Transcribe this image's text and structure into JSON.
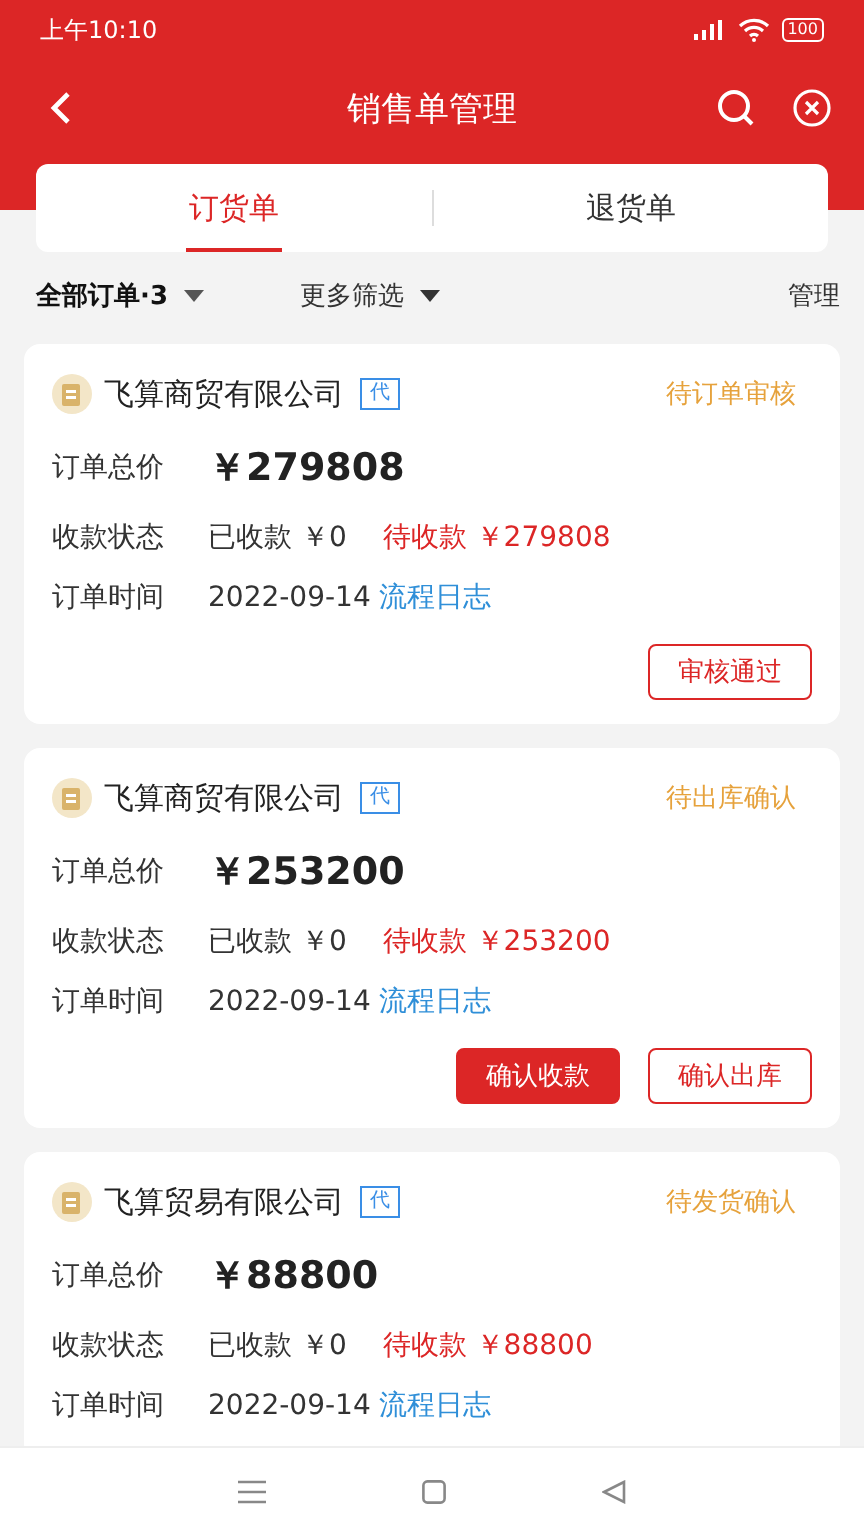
{
  "status_bar": {
    "time": "上午10:10",
    "battery": "100"
  },
  "header": {
    "title": "销售单管理"
  },
  "tabs": [
    {
      "label": "订货单",
      "selected": true
    },
    {
      "label": "退货单",
      "selected": false
    }
  ],
  "filters": {
    "all_orders": "全部订单·3",
    "more_filters": "更多筛选",
    "manage": "管理"
  },
  "orders": [
    {
      "company": "飞算商贸有限公司",
      "tag": "代",
      "status": "待订单审核",
      "total_label": "订单总价",
      "total": "￥279808",
      "payment_label": "收款状态",
      "received": "已收款 ￥0",
      "pending": "待收款 ￥279808",
      "time_label": "订单时间",
      "date": "2022-09-14",
      "log_link": "流程日志",
      "buttons": [
        {
          "label": "审核通过",
          "kind": "outline"
        }
      ]
    },
    {
      "company": "飞算商贸有限公司",
      "tag": "代",
      "status": "待出库确认",
      "total_label": "订单总价",
      "total": "￥253200",
      "payment_label": "收款状态",
      "received": "已收款 ￥0",
      "pending": "待收款 ￥253200",
      "time_label": "订单时间",
      "date": "2022-09-14",
      "log_link": "流程日志",
      "buttons": [
        {
          "label": "确认收款",
          "kind": "primary"
        },
        {
          "label": "确认出库",
          "kind": "outline"
        }
      ]
    },
    {
      "company": "飞算贸易有限公司",
      "tag": "代",
      "status": "待发货确认",
      "total_label": "订单总价",
      "total": "￥88800",
      "payment_label": "收款状态",
      "received": "已收款 ￥0",
      "pending": "待收款 ￥88800",
      "time_label": "订单时间",
      "date": "2022-09-14",
      "log_link": "流程日志"
    }
  ]
}
